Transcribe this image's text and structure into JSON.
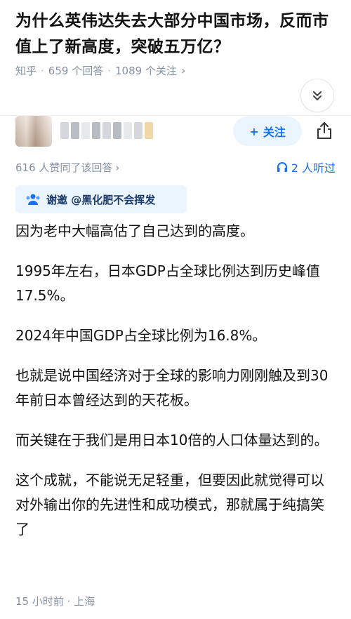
{
  "question": {
    "title": "为什么英伟达失去大部分中国市场，反而市值上了新高度，突破五万亿？",
    "source": "知乎",
    "answers": "659 个回答",
    "followers": "1089 个关注",
    "sep": "·"
  },
  "answer": {
    "follow_label": "关注",
    "follow_plus": "+",
    "likes": "616 人赞同了该回答",
    "listeners": "2 人听过",
    "invite": "谢邀 @黑化肥不会挥发",
    "paragraphs": [
      "因为老中大幅高估了自己达到的高度。",
      "1995年左右，日本GDP占全球比例达到历史峰值17.5%。",
      "2024年中国GDP占全球比例为16.8%。",
      "也就是说中国经济对于全球的影响力刚刚触及到30年前日本曾经达到的天花板。",
      "而关键在于我们是用日本10倍的人口体量达到的。",
      "这个成就，不能说无足轻重，但要因此就觉得可以对外输出你的先进性和成功模式，那就属于纯搞笑了"
    ],
    "time_location": "15 小时前 · 上海"
  },
  "icons": {
    "expand": "chevron-double-down-icon",
    "share": "share-icon",
    "headphones": "headphones-icon",
    "invite": "people-icon",
    "chevron": "chevron-right-icon"
  },
  "colors": {
    "accent": "#1772f6",
    "accent_bg": "#ebf5ff",
    "meta": "#8590a6"
  }
}
